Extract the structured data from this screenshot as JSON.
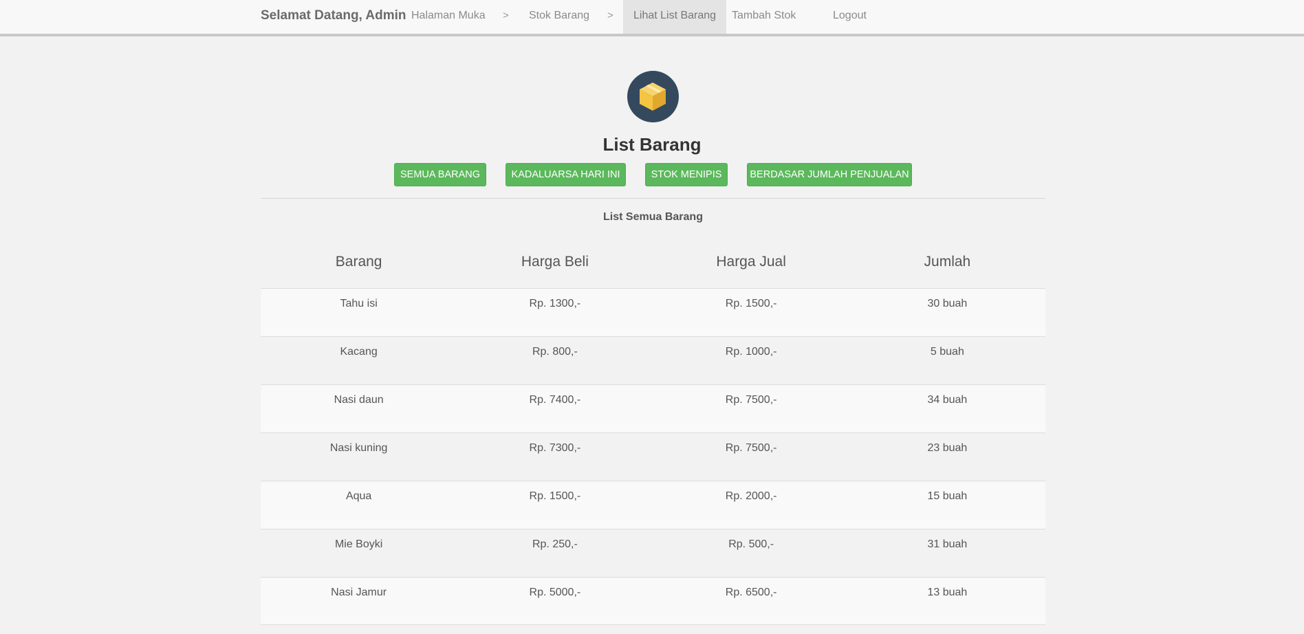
{
  "nav": {
    "brand": "Selamat Datang, Admin",
    "items": [
      {
        "label": "Halaman Muka"
      },
      {
        "label": "Stok Barang"
      },
      {
        "label": "Lihat List Barang",
        "active": true
      },
      {
        "label": "Tambah Stok"
      },
      {
        "label": "Logout"
      }
    ],
    "separator": ">"
  },
  "header": {
    "icon": "package-box-icon",
    "title": "List Barang"
  },
  "filters": [
    {
      "label": "SEMUA BARANG"
    },
    {
      "label": "KADALUARSA HARI INI"
    },
    {
      "label": "STOK MENIPIS"
    },
    {
      "label": "BERDASAR JUMLAH PENJUALAN"
    }
  ],
  "list": {
    "caption": "List Semua Barang",
    "columns": [
      "Barang",
      "Harga Beli",
      "Harga Jual",
      "Jumlah"
    ],
    "rows": [
      [
        "Tahu isi",
        "Rp. 1300,-",
        "Rp. 1500,-",
        "30 buah"
      ],
      [
        "Kacang",
        "Rp. 800,-",
        "Rp. 1000,-",
        "5 buah"
      ],
      [
        "Nasi daun",
        "Rp. 7400,-",
        "Rp. 7500,-",
        "34 buah"
      ],
      [
        "Nasi kuning",
        "Rp. 7300,-",
        "Rp. 7500,-",
        "23 buah"
      ],
      [
        "Aqua",
        "Rp. 1500,-",
        "Rp. 2000,-",
        "15 buah"
      ],
      [
        "Mie Boyki",
        "Rp. 250,-",
        "Rp. 500,-",
        "31 buah"
      ],
      [
        "Nasi Jamur",
        "Rp. 5000,-",
        "Rp. 6500,-",
        "13 buah"
      ]
    ]
  },
  "colors": {
    "accent": "#5cb85c",
    "icon_bg": "#34495e",
    "box": "#f4c542"
  }
}
